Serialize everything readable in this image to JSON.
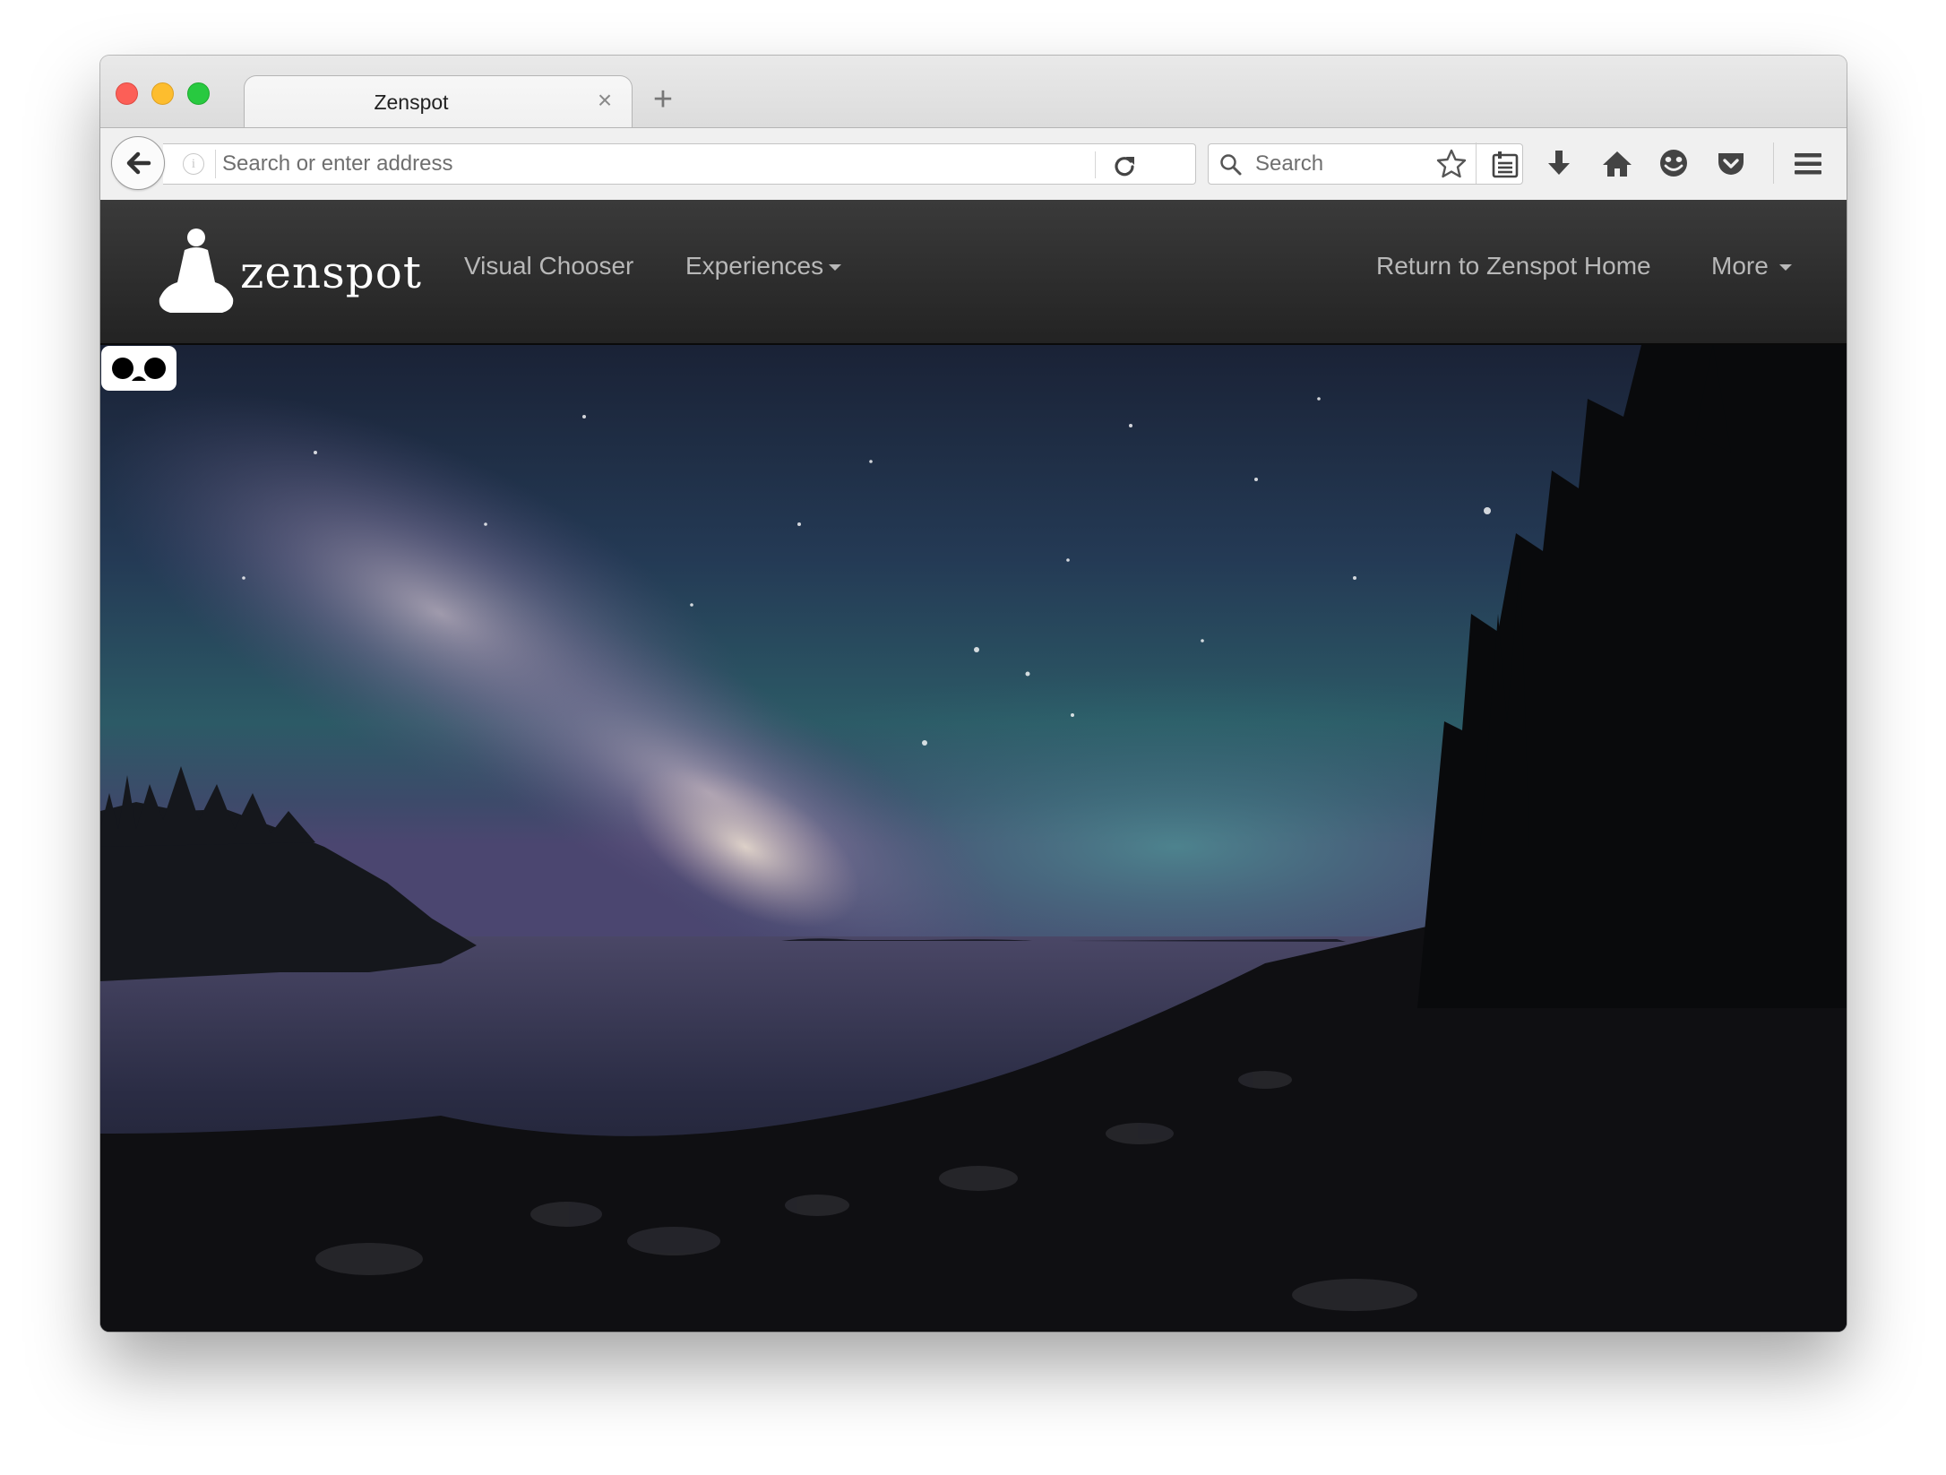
{
  "browser": {
    "tab": {
      "title": "Zenspot",
      "close_glyph": "×"
    },
    "new_tab_glyph": "+",
    "address_bar": {
      "placeholder": "Search or enter address",
      "value": ""
    },
    "search_bar": {
      "placeholder": "Search",
      "value": ""
    },
    "toolbar_icons": [
      "star-icon",
      "reading-list-icon",
      "download-icon",
      "home-icon",
      "hello-icon",
      "pocket-icon",
      "menu-icon"
    ]
  },
  "site": {
    "brand": "zenspot",
    "nav": {
      "visual_chooser": "Visual Chooser",
      "experiences": "Experiences",
      "return_home": "Return to Zenspot Home",
      "more": "More"
    },
    "hero": {
      "scene": "night-sky-coastline",
      "vr_icon": "vr-headset-icon"
    }
  },
  "colors": {
    "nav_bg": "#2b2b2b",
    "nav_text": "#b8b8b8",
    "brand_text": "#ffffff"
  }
}
